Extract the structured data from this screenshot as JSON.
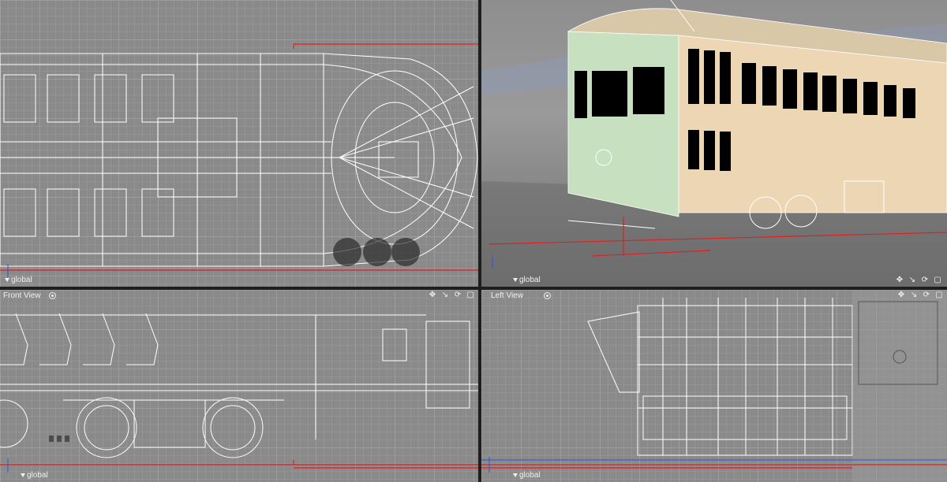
{
  "viewports": {
    "top": {
      "global": "global"
    },
    "perspective": {
      "global": "global"
    },
    "front": {
      "title": "Front View",
      "global": "global"
    },
    "left": {
      "title": "Left View",
      "global": "global"
    }
  },
  "tools": {
    "move": "✥",
    "zoom": "↘",
    "rotate": "⟳",
    "maximize": "▢"
  },
  "colors": {
    "wire": "#ffffff",
    "axis_red": "#e02020",
    "axis_blue": "#3050d0",
    "tram_green": "#c6e0c0",
    "tram_cream": "#ecd6b4"
  },
  "icons": [
    "move-icon",
    "zoom-icon",
    "rotate-icon",
    "maximize-icon",
    "camera-icon"
  ]
}
